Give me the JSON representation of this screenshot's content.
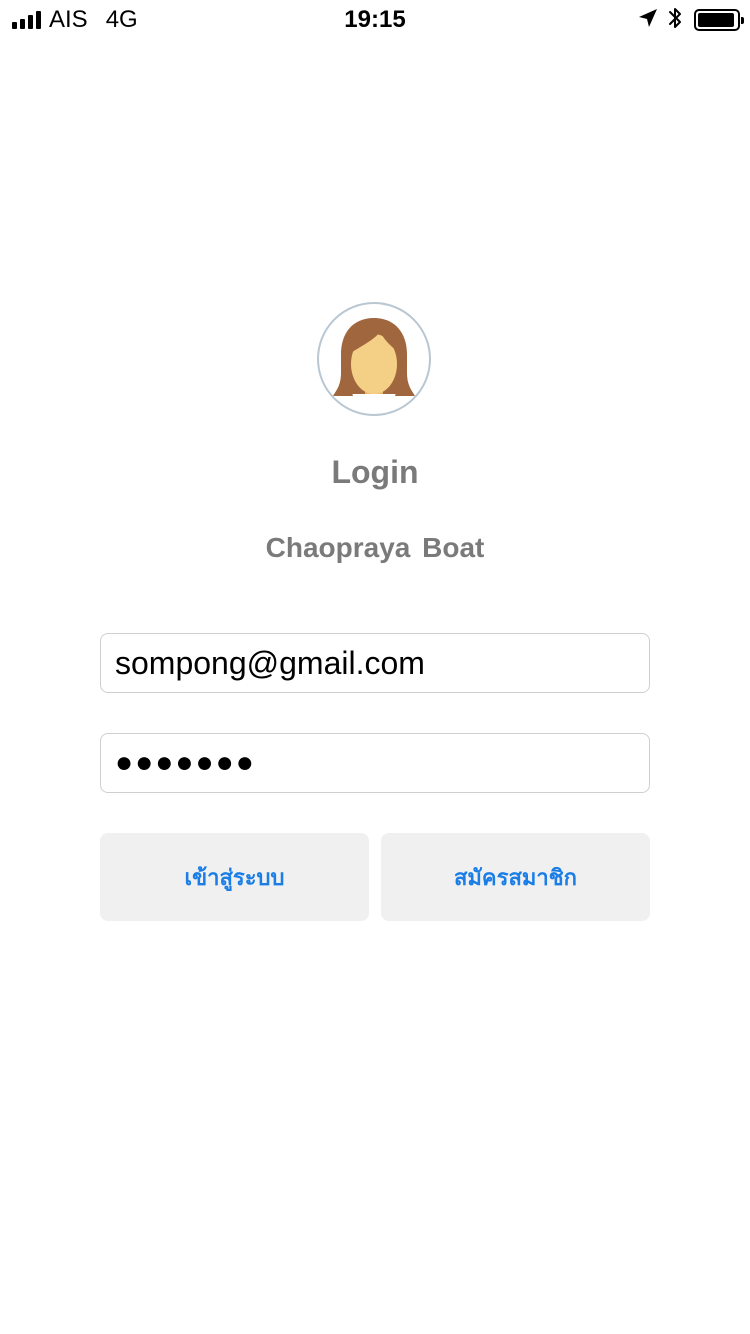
{
  "status_bar": {
    "carrier": "AIS",
    "network": "4G",
    "time": "19:15",
    "icons": [
      "signal-icon",
      "location-arrow-icon",
      "bluetooth-icon",
      "battery-icon"
    ],
    "battery_level": 0.95
  },
  "avatar": {
    "icon": "female-avatar-icon"
  },
  "login": {
    "title": "Login",
    "subtitle": "Chaopraya Boat",
    "email_value": "sompong@gmail.com",
    "password_masked": "●●●●●●●",
    "login_button_label": "เข้าสู่ระบบ",
    "register_button_label": "สมัครสมาชิก"
  },
  "colors": {
    "button_text": "#1a7ee6",
    "button_bg": "#f0f0f0",
    "title_text": "#7a7a7a",
    "field_border": "#cfcfcf",
    "avatar_ring": "#b9c7d3"
  }
}
